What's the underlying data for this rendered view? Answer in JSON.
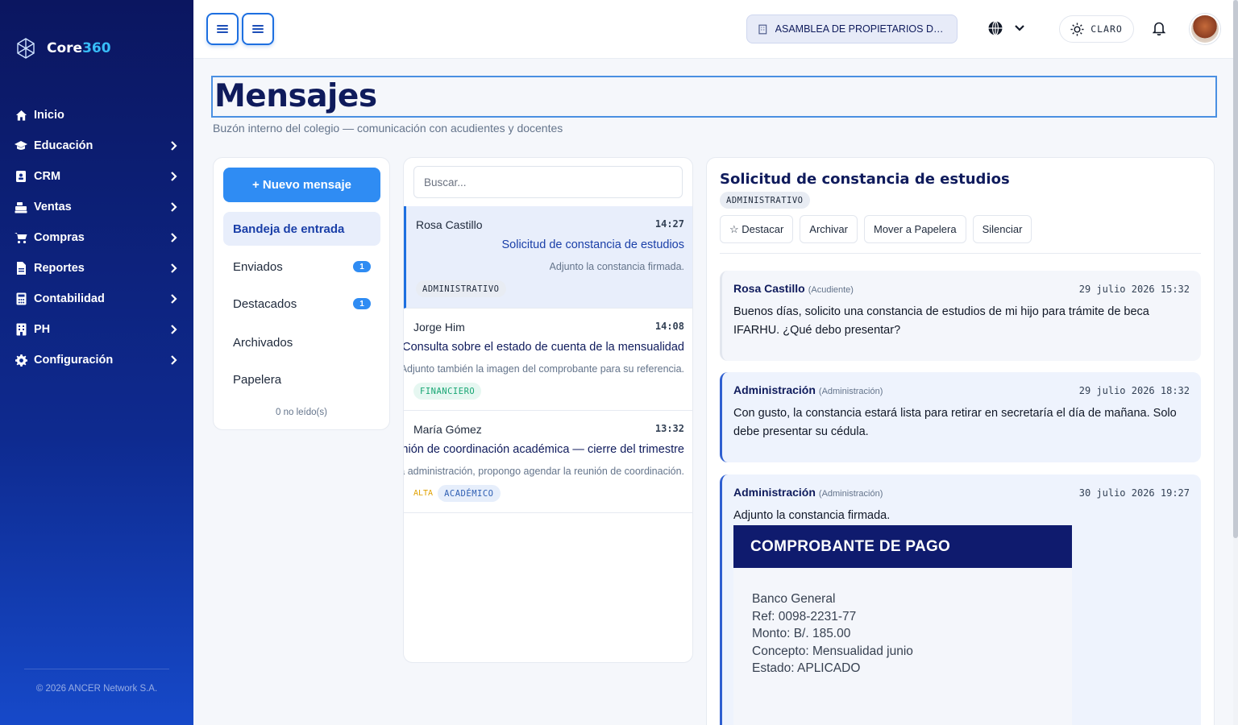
{
  "app": {
    "logo_prefix": "Core",
    "logo_accent": "360",
    "copyright": "© 2026 ANCER Network S.A."
  },
  "nav": [
    {
      "label": "Inicio",
      "icon": "home-icon"
    },
    {
      "label": "Educación",
      "icon": "graduation-cap-icon"
    },
    {
      "label": "CRM",
      "icon": "contacts-book-icon"
    },
    {
      "label": "Ventas",
      "icon": "cash-register-icon"
    },
    {
      "label": "Compras",
      "icon": "shopping-cart-icon"
    },
    {
      "label": "Reportes",
      "icon": "file-report-icon"
    },
    {
      "label": "Contabilidad",
      "icon": "calculator-icon"
    },
    {
      "label": "PH",
      "icon": "building-icon"
    },
    {
      "label": "Configuración",
      "icon": "gear-icon"
    }
  ],
  "topbar": {
    "organization": "ASAMBLEA DE PROPIETARIOS DE ...",
    "theme_label": "CLARO"
  },
  "page": {
    "title": "Mensajes",
    "subtitle": "Buzón interno del colegio — comunicación con acudientes y docentes"
  },
  "folders": {
    "new_message": "+ Nuevo mensaje",
    "items": [
      {
        "label": "Bandeja de entrada",
        "count": ""
      },
      {
        "label": "Enviados",
        "count": "1"
      },
      {
        "label": "Destacados",
        "count": "1"
      },
      {
        "label": "Archivados",
        "count": ""
      },
      {
        "label": "Papelera",
        "count": ""
      }
    ],
    "unread": "0 no leído(s)"
  },
  "list": {
    "search_placeholder": "Buscar...",
    "messages": [
      {
        "from": "Rosa Castillo",
        "time": "14:27",
        "subject": "Solicitud de constancia de estudios",
        "preview": "Adjunto la constancia firmada.",
        "priority": "",
        "tag": "ADMINISTRATIVO"
      },
      {
        "from": "Jorge Him",
        "time": "14:08",
        "subject": "Consulta sobre el estado de cuenta de la mensualidad",
        "preview": "Adjunto también la imagen del comprobante para su referencia.",
        "priority": "",
        "tag": "FINANCIERO"
      },
      {
        "from": "María Gómez",
        "time": "13:32",
        "subject": "Reunión de coordinación académica — cierre del trimestre",
        "preview": "Estimada administración, propongo agendar la reunión de coordinación.",
        "priority": "ALTA",
        "tag": "ACADÉMICO"
      }
    ]
  },
  "detail": {
    "title": "Solicitud de constancia de estudios",
    "tag": "ADMINISTRATIVO",
    "actions": [
      "☆ Destacar",
      "Archivar",
      "Mover a Papelera",
      "Silenciar"
    ],
    "thread": [
      {
        "name": "Rosa Castillo",
        "role": "(Acudiente)",
        "date": "29 julio 2026 15:32",
        "body": "Buenos días, solicito una constancia de estudios de mi hijo para trámite de beca IFARHU. ¿Qué debo presentar?"
      },
      {
        "name": "Administración",
        "role": "(Administración)",
        "date": "29 julio 2026 18:32",
        "body": "Con gusto, la constancia estará lista para retirar en secretaría el día de mañana. Solo debe presentar su cédula."
      },
      {
        "name": "Administración",
        "role": "(Administración)",
        "date": "30 julio 2026 19:27",
        "body": "Adjunto la constancia firmada."
      }
    ],
    "attachment": {
      "header": "COMPROBANTE DE PAGO",
      "lines": [
        "Banco General",
        "Ref: 0098-2231-77",
        "Monto: B/. 185.00",
        "Concepto: Mensualidad junio",
        "Estado: APLICADO"
      ]
    }
  }
}
